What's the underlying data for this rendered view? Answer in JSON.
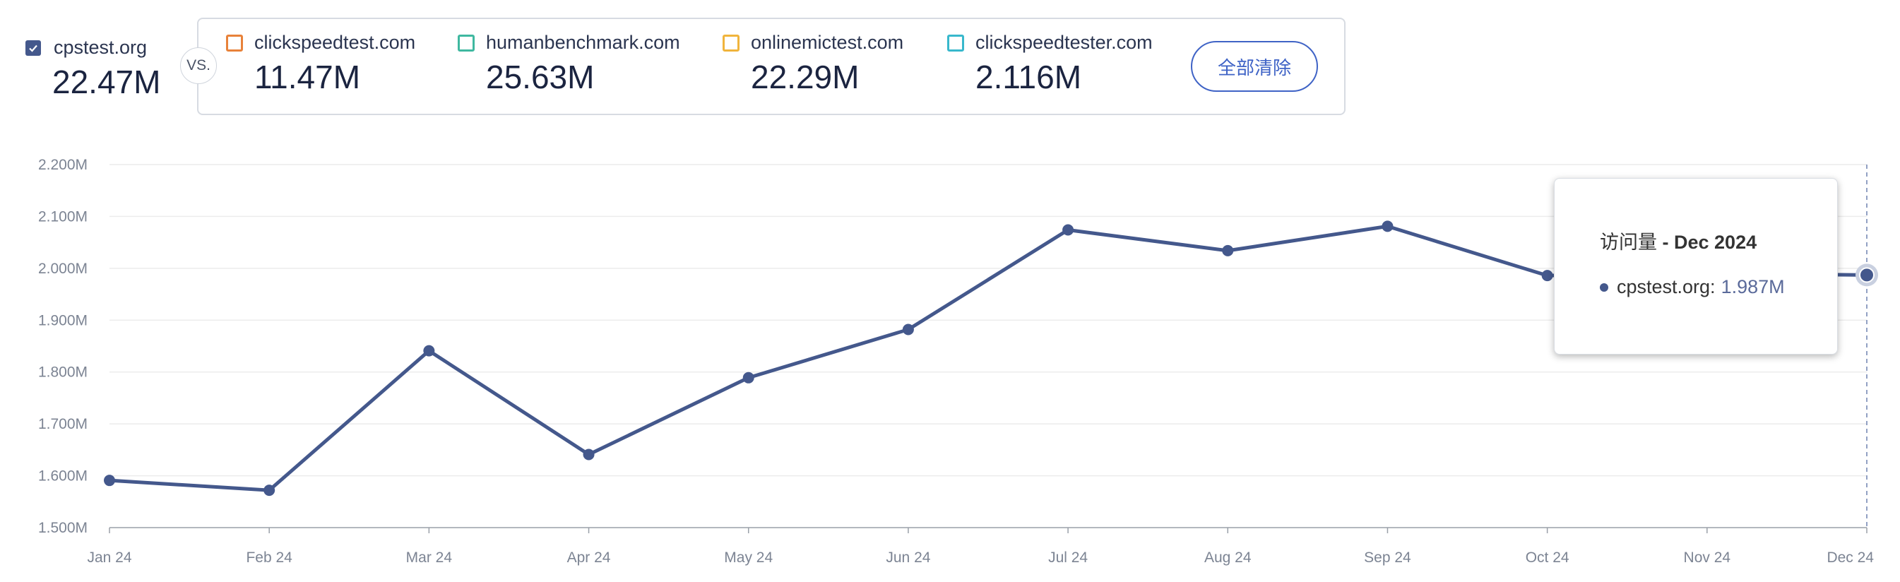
{
  "primary": {
    "domain": "cpstest.org",
    "value": "22.47M",
    "color": "#44588c"
  },
  "vs_label": "VS.",
  "competitors": [
    {
      "domain": "clickspeedtest.com",
      "value": "11.47M",
      "color": "#e8823a"
    },
    {
      "domain": "humanbenchmark.com",
      "value": "25.63M",
      "color": "#3fb8a0"
    },
    {
      "domain": "onlinemictest.com",
      "value": "22.29M",
      "color": "#f0b43c"
    },
    {
      "domain": "clickspeedtester.com",
      "value": "2.116M",
      "color": "#38b8cc"
    }
  ],
  "clear_all_label": "全部清除",
  "tooltip": {
    "title_prefix": "访问量",
    "title_sep": " - ",
    "title_month": "Dec 2024",
    "series_label": "cpstest.org:",
    "series_value": "1.987M"
  },
  "chart_data": {
    "type": "line",
    "x": [
      "Jan 24",
      "Feb 24",
      "Mar 24",
      "Apr 24",
      "May 24",
      "Jun 24",
      "Jul 24",
      "Aug 24",
      "Sep 24",
      "Oct 24",
      "Nov 24",
      "Dec 24"
    ],
    "series": [
      {
        "name": "cpstest.org",
        "color": "#44588c",
        "values": [
          1.591,
          1.572,
          1.841,
          1.641,
          1.789,
          1.882,
          2.074,
          2.034,
          2.081,
          1.986,
          1.99,
          1.987
        ]
      }
    ],
    "y_ticks": [
      "1.500M",
      "1.600M",
      "1.700M",
      "1.800M",
      "1.900M",
      "2.000M",
      "2.100M",
      "2.200M"
    ],
    "ylim": [
      1.5,
      2.2
    ],
    "grid": true,
    "highlighted_point": "Dec 24"
  }
}
